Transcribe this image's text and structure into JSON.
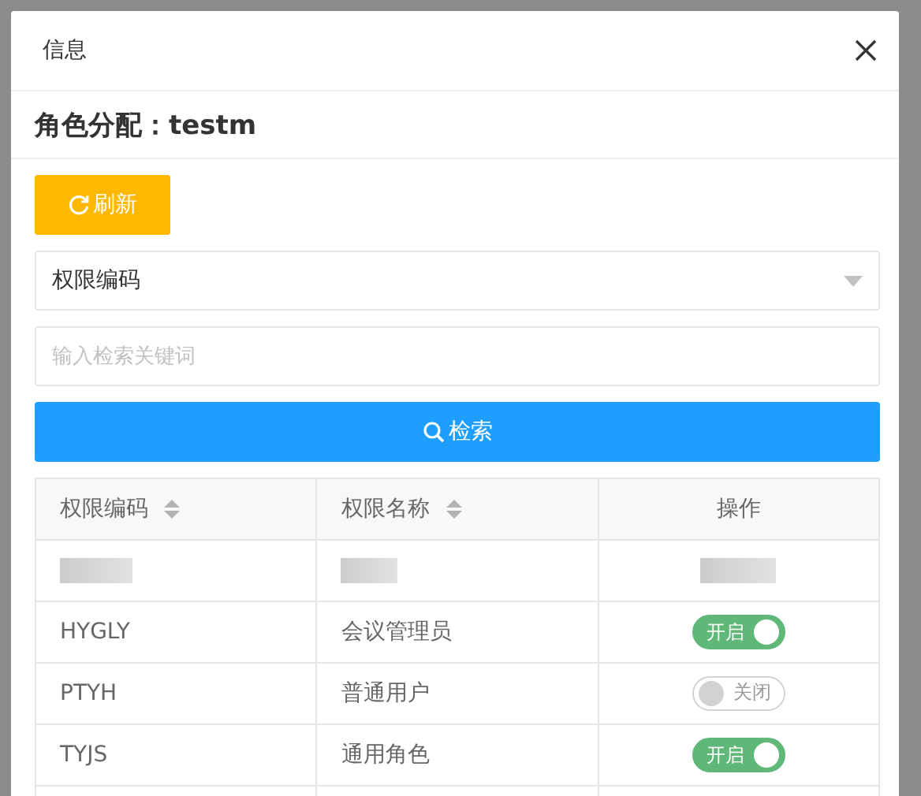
{
  "dialog": {
    "title": "信息",
    "heading": "角色分配：testm"
  },
  "toolbar": {
    "refresh_button": "刷新"
  },
  "filter": {
    "select_value": "权限编码",
    "search_placeholder": "输入检索关键词",
    "search_button": "检索"
  },
  "table": {
    "columns": [
      {
        "label": "权限编码",
        "sortable": true
      },
      {
        "label": "权限名称",
        "sortable": true
      },
      {
        "label": "操作",
        "sortable": false
      }
    ],
    "rows": [
      {
        "kind": "redacted"
      },
      {
        "kind": "permission",
        "code": "HYGLY",
        "name": "会议管理员",
        "on": true,
        "switch_label": "开启"
      },
      {
        "kind": "permission",
        "code": "PTYH",
        "name": "普通用户",
        "on": false,
        "switch_label": "关闭"
      },
      {
        "kind": "permission",
        "code": "TYJS",
        "name": "通用角色",
        "on": true,
        "switch_label": "开启"
      }
    ]
  }
}
